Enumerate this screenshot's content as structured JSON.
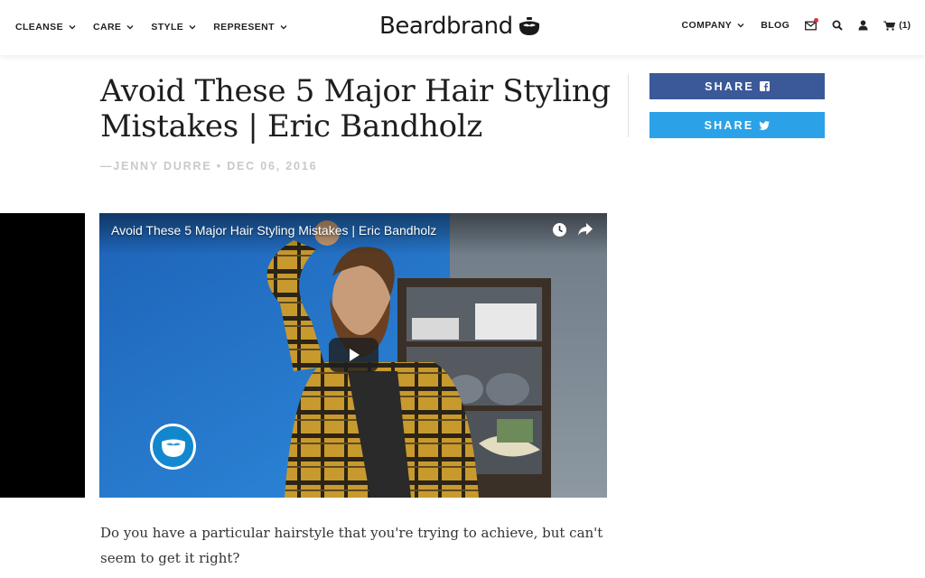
{
  "header": {
    "nav_left": [
      {
        "label": "CLEANSE"
      },
      {
        "label": "CARE"
      },
      {
        "label": "STYLE"
      },
      {
        "label": "REPRESENT"
      }
    ],
    "logo_text": "Beardbrand",
    "nav_right": {
      "company": "COMPANY",
      "blog": "BLOG",
      "cart_count": "(1)"
    },
    "icons": [
      "mail-icon",
      "search-icon",
      "user-icon",
      "cart-icon"
    ],
    "notification_color": "#e0303a"
  },
  "article": {
    "title": "Avoid These 5 Major Hair Styling Mistakes | Eric Bandholz",
    "byline": "—JENNY DURRE • DEC 06, 2016",
    "body": "Do you have a particular hairstyle that you're trying to achieve, but can't seem to get it right?"
  },
  "share": {
    "facebook_label": "SHARE",
    "twitter_label": "SHARE",
    "facebook_color": "#3b5998",
    "twitter_color": "#2ba2e8"
  },
  "video": {
    "title": "Avoid These 5 Major Hair Styling Mistakes | Eric Bandholz",
    "icons": [
      "clock-icon",
      "share-arrow-icon",
      "play-icon",
      "brand-badge-icon"
    ]
  }
}
